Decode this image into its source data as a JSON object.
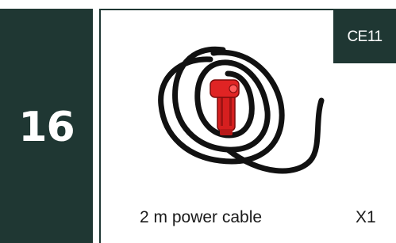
{
  "index": {
    "number": "16"
  },
  "item": {
    "code": "CE11",
    "label": "2 m power cable",
    "quantity": "X1",
    "image_icon": "coiled-power-cable-icon"
  },
  "colors": {
    "panel": "#1f3733",
    "cable": "#111111",
    "plug": "#d61f1f"
  }
}
